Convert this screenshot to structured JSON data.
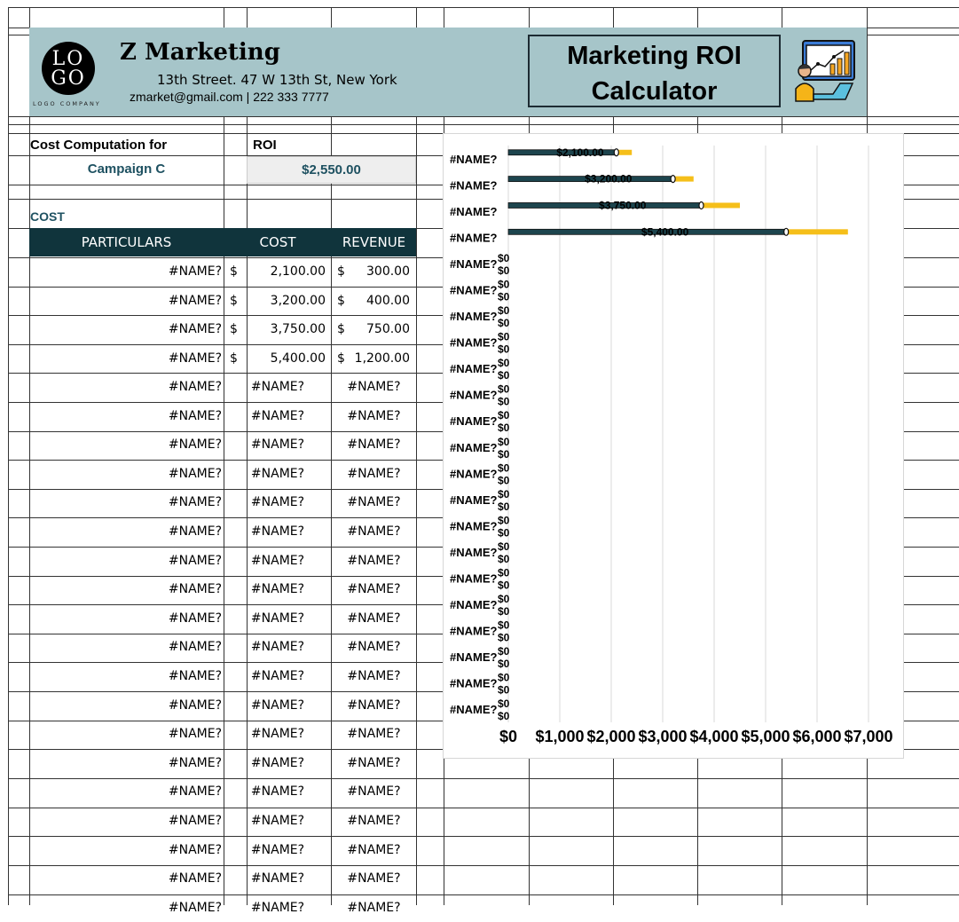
{
  "header": {
    "logo_top": "LO",
    "logo_bottom": "GO",
    "logo_caption": "LOGO COMPANY",
    "company": "Z Marketing",
    "address": "13th Street. 47 W 13th St, New York",
    "contact": "zmarket@gmail.com | 222 333 7777",
    "title_line1": "Marketing ROI",
    "title_line2": "Calculator",
    "title_icon": "analytics-person-icon"
  },
  "summary": {
    "cost_for_label": "Cost Computation for",
    "campaign": "Campaign C",
    "roi_label": "ROI",
    "roi_value": "$2,550.00",
    "section": "COST"
  },
  "table": {
    "headers": [
      "PARTICULARS",
      "COST",
      "REVENUE"
    ],
    "currency": "$",
    "rows": [
      {
        "particular": "#NAME?",
        "cost": "2,100.00",
        "revenue": "300.00"
      },
      {
        "particular": "#NAME?",
        "cost": "3,200.00",
        "revenue": "400.00"
      },
      {
        "particular": "#NAME?",
        "cost": "3,750.00",
        "revenue": "750.00"
      },
      {
        "particular": "#NAME?",
        "cost": "5,400.00",
        "revenue": "1,200.00"
      }
    ],
    "error_rows": 19,
    "error_text": "#NAME?"
  },
  "colors": {
    "band": "#a6c5c9",
    "header_dark": "#10343c",
    "accent_text": "#1e5161",
    "bar_cost": "#1d454e",
    "bar_revenue": "#f5bf1a"
  },
  "chart_data": {
    "type": "bar",
    "orientation": "horizontal",
    "category_label": "#NAME?",
    "categories": 22,
    "series": [
      {
        "values": [
          2100,
          3200,
          3750,
          5400
        ]
      },
      {
        "values": [
          300,
          400,
          750,
          1200
        ]
      }
    ],
    "data_labels": [
      "$2,100.00",
      "$3,200.00",
      "$3,750.00",
      "$5,400.00"
    ],
    "zero_label": "$0",
    "xlim": [
      0,
      7000
    ],
    "x_ticks": [
      "$0",
      "$1,000",
      "$2,000",
      "$3,000",
      "$4,000",
      "$5,000",
      "$6,000",
      "$7,000"
    ],
    "grid": true
  }
}
